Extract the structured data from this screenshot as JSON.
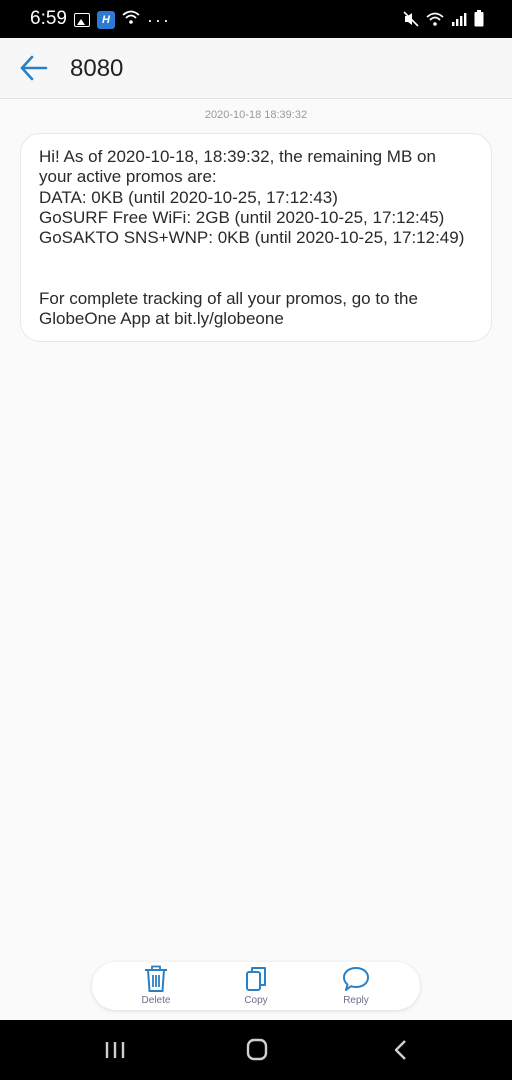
{
  "status_bar": {
    "time": "6:59",
    "left_icons": [
      "image-icon",
      "app-notification-icon",
      "wifi-icon",
      "more-dots-icon"
    ],
    "right_icons": [
      "mute-icon",
      "wifi-icon",
      "signal-icon",
      "battery-icon"
    ],
    "app_badge": "H",
    "dots": "···"
  },
  "header": {
    "title": "8080"
  },
  "conversation": {
    "timestamp": "2020-10-18 18:39:32",
    "message_lines": [
      "Hi! As of 2020-10-18, 18:39:32, the remaining MB on",
      "your active promos are:",
      "DATA: 0KB (until 2020-10-25, 17:12:43)",
      "GoSURF Free WiFi: 2GB (until 2020-10-25, 17:12:45)",
      "GoSAKTO SNS+WNP: 0KB (until 2020-10-25, 17:12:49)",
      "For complete tracking of all your promos, go to the",
      "GlobeOne App at bit.ly/globeone"
    ]
  },
  "actions": {
    "delete_label": "Delete",
    "copy_label": "Copy",
    "reply_label": "Reply",
    "accent_color": "#2a80c4"
  },
  "colors": {
    "background": "#fafafa",
    "bubble": "#ffffff",
    "back_arrow": "#2a80c4"
  }
}
